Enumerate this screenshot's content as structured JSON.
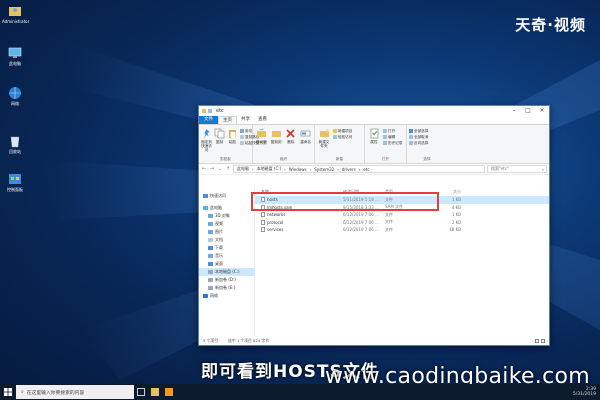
{
  "watermark": {
    "brand": "天奇·视频",
    "caption": "即可看到HOSTS文件",
    "site": "www.caodingbaike.com"
  },
  "desktop": {
    "icons": [
      {
        "label": "Administrator",
        "icon": "user-folder-icon"
      },
      {
        "label": "此电脑",
        "icon": "this-pc-icon"
      },
      {
        "label": "网络",
        "icon": "network-icon"
      },
      {
        "label": "回收站",
        "icon": "recycle-bin-icon"
      },
      {
        "label": "控制面板",
        "icon": "control-panel-icon"
      }
    ]
  },
  "window": {
    "title": "etc",
    "tabs": [
      "文件",
      "主页",
      "共享",
      "查看"
    ],
    "ribbon": {
      "clipboard": {
        "name": "剪贴板",
        "pin": "固定到快速访问",
        "copy": "复制",
        "paste": "粘贴",
        "cut": "剪切",
        "copy_path": "复制路径",
        "paste_shortcut": "粘贴快捷方式"
      },
      "organize": {
        "name": "组织",
        "move_to": "移动到",
        "copy_to": "复制到",
        "delete": "删除",
        "rename": "重命名"
      },
      "new": {
        "name": "新建",
        "new_folder": "新建文件夹",
        "new_item": "新建项目",
        "easy_access": "轻松访问"
      },
      "open": {
        "name": "打开",
        "properties": "属性",
        "open": "打开",
        "edit": "编辑",
        "history": "历史记录"
      },
      "select": {
        "name": "选择",
        "select_all": "全部选择",
        "select_none": "全部取消",
        "invert": "反向选择"
      }
    },
    "address": {
      "parts": [
        "此电脑",
        "本地磁盘 (C:)",
        "Windows",
        "System32",
        "drivers",
        "etc"
      ],
      "search_placeholder": "搜索\"etc\""
    },
    "nav": [
      {
        "label": "快速访问",
        "icon": "star-icon",
        "selected": false
      },
      {
        "label": "此电脑",
        "icon": "this-pc-icon",
        "selected": false
      },
      {
        "label": "3D 对象",
        "icon": "cube-icon",
        "selected": false
      },
      {
        "label": "视频",
        "icon": "video-icon",
        "selected": false
      },
      {
        "label": "图片",
        "icon": "picture-icon",
        "selected": false
      },
      {
        "label": "文档",
        "icon": "document-icon",
        "selected": false
      },
      {
        "label": "下载",
        "icon": "download-icon",
        "selected": false
      },
      {
        "label": "音乐",
        "icon": "music-icon",
        "selected": false
      },
      {
        "label": "桌面",
        "icon": "desktop-icon",
        "selected": false
      },
      {
        "label": "本地磁盘 (C:)",
        "icon": "drive-icon",
        "selected": true
      },
      {
        "label": "新加卷 (D:)",
        "icon": "drive-icon",
        "selected": false
      },
      {
        "label": "新加卷 (E:)",
        "icon": "drive-icon",
        "selected": false
      },
      {
        "label": "网络",
        "icon": "network-icon",
        "selected": false
      }
    ],
    "columns": [
      "名称",
      "修改日期",
      "类型",
      "大小"
    ],
    "files": [
      {
        "name": "hosts",
        "date": "5/31/2019 5:18 ...",
        "type": "文件",
        "size": "1 KB",
        "selected": true
      },
      {
        "name": "lmhosts.sam",
        "date": "9/15/2018 3:33 ...",
        "type": "SAM 文件",
        "size": "4 KB",
        "selected": false
      },
      {
        "name": "networks",
        "date": "6/12/2019 7:06 ...",
        "type": "文件",
        "size": "1 KB",
        "selected": false
      },
      {
        "name": "protocol",
        "date": "6/12/2019 7:06 ...",
        "type": "文件",
        "size": "2 KB",
        "selected": false
      },
      {
        "name": "services",
        "date": "6/12/2019 7:06 ...",
        "type": "文件",
        "size": "18 KB",
        "selected": false
      }
    ],
    "status": {
      "count": "5 个项目",
      "selected": "选中 1 个项目 824 字节"
    }
  },
  "taskbar": {
    "search_placeholder": "在这里输入你要搜索的内容",
    "time": "2:39",
    "date": "5/31/2019"
  },
  "colors": {
    "accent": "#1979ca",
    "highlight_box": "#e0403a",
    "selection": "#cce8ff"
  }
}
